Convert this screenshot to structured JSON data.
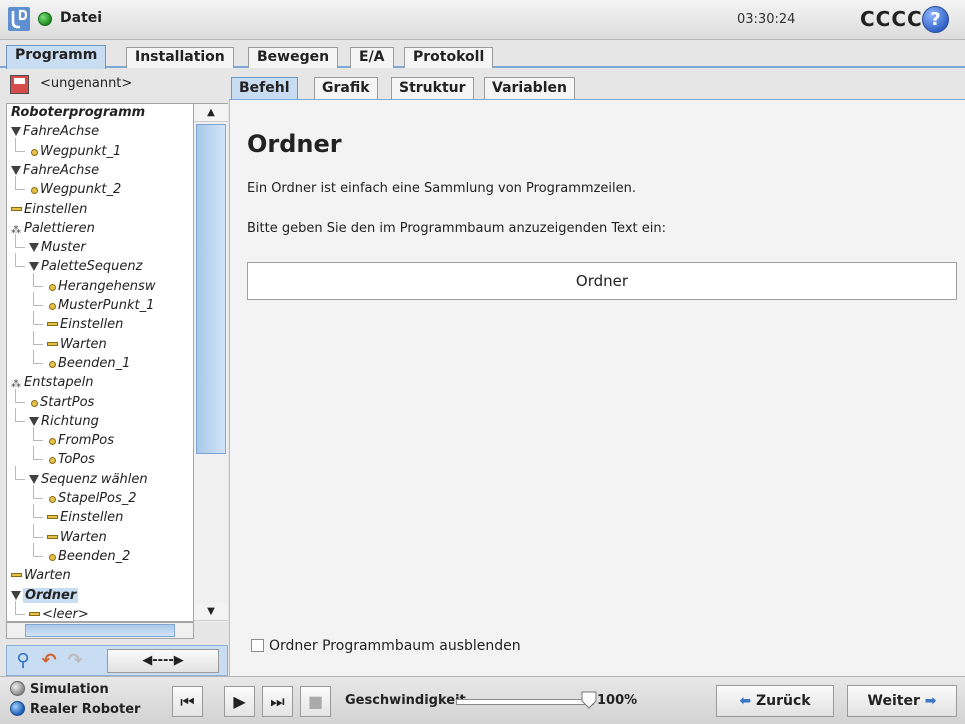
{
  "titlebar": {
    "file_menu": "Datei",
    "clock": "03:30:24",
    "robot_name": "CCCC",
    "help_label": "?",
    "brand_color": "#3b78c8"
  },
  "main_tabs": [
    "Programm",
    "Installation",
    "Bewegen",
    "E/A",
    "Protokoll"
  ],
  "active_main_tab": "Programm",
  "left": {
    "program_name": "<ungenannt>",
    "tree": [
      {
        "label": "Roboterprogramm",
        "icon": "none",
        "bold": true
      },
      {
        "label": "FahreAchse",
        "icon": "triangle-icon"
      },
      {
        "label": "Wegpunkt_1",
        "icon": "waypoint-icon"
      },
      {
        "label": "FahreAchse",
        "icon": "triangle-icon"
      },
      {
        "label": "Wegpunkt_2",
        "icon": "waypoint-icon"
      },
      {
        "label": "Einstellen",
        "icon": "bar-icon"
      },
      {
        "label": "Palettieren",
        "icon": "pallet-icon"
      },
      {
        "label": "Muster",
        "icon": "triangle-icon"
      },
      {
        "label": "PaletteSequenz",
        "icon": "triangle-icon"
      },
      {
        "label": "Herangehensw",
        "icon": "waypoint-icon"
      },
      {
        "label": "MusterPunkt_1",
        "icon": "waypoint-icon"
      },
      {
        "label": "Einstellen",
        "icon": "bar-icon"
      },
      {
        "label": "Warten",
        "icon": "bar-icon"
      },
      {
        "label": "Beenden_1",
        "icon": "waypoint-icon"
      },
      {
        "label": "Entstapeln",
        "icon": "pallet-icon"
      },
      {
        "label": "StartPos",
        "icon": "waypoint-icon"
      },
      {
        "label": "Richtung",
        "icon": "triangle-icon"
      },
      {
        "label": "FromPos",
        "icon": "waypoint-icon"
      },
      {
        "label": "ToPos",
        "icon": "waypoint-icon"
      },
      {
        "label": "Sequenz wählen",
        "icon": "triangle-icon"
      },
      {
        "label": "StapelPos_2",
        "icon": "waypoint-icon"
      },
      {
        "label": "Einstellen",
        "icon": "bar-icon"
      },
      {
        "label": "Warten",
        "icon": "bar-icon"
      },
      {
        "label": "Beenden_2",
        "icon": "waypoint-icon"
      },
      {
        "label": "Warten",
        "icon": "bar-icon"
      },
      {
        "label": "Ordner",
        "icon": "triangle-icon",
        "bold": true,
        "selected": true
      },
      {
        "label": "<leer>",
        "icon": "bar-icon"
      }
    ],
    "tools": {
      "move_label": "◀----▶"
    }
  },
  "sub_tabs": [
    "Befehl",
    "Grafik",
    "Struktur",
    "Variablen"
  ],
  "active_sub_tab": "Befehl",
  "content": {
    "heading": "Ordner",
    "description": "Ein Ordner ist einfach eine Sammlung von Programmzeilen.",
    "prompt": "Bitte geben Sie den im Programmbaum anzuzeigenden Text ein:",
    "folder_text_value": "Ordner",
    "hide_checkbox_label": "Ordner Programmbaum ausblenden",
    "hide_checkbox_checked": false
  },
  "footer": {
    "mode_simulation": "Simulation",
    "mode_real": "Realer Roboter",
    "selected_mode": "Realer Roboter",
    "speed_label": "Geschwindigkeit",
    "speed_value": "100%",
    "speed_fraction": 1.0,
    "back_label": "Zurück",
    "next_label": "Weiter"
  }
}
